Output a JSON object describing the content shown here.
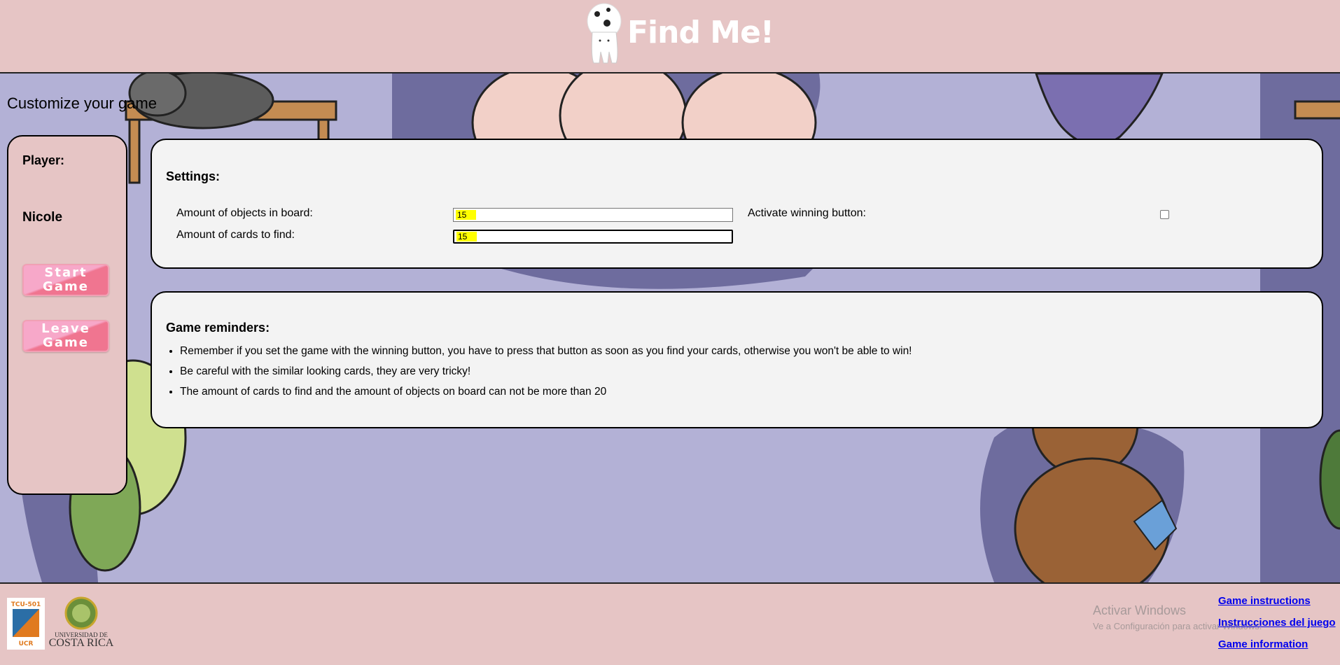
{
  "header": {
    "title": "Find Me!"
  },
  "main": {
    "heading": "Customize your game",
    "sidebar": {
      "player_label": "Player:",
      "player_name": "Nicole",
      "start_button": "Start Game",
      "leave_button": "Leave Game"
    },
    "settings": {
      "title": "Settings:",
      "objects_label": "Amount of objects in board:",
      "objects_value": "15",
      "cards_label": "Amount of cards to find:",
      "cards_value": "15",
      "winning_label": "Activate winning button:",
      "winning_checked": false
    },
    "reminders": {
      "title": "Game reminders:",
      "items": [
        "Remember if you set the game with the winning button, you have to press that button as soon as you find your cards, otherwise you won't be able to win!",
        "Be careful with the similar looking cards, they are very tricky!",
        "The amount of cards to find and the amount of objects on board can not be more than 20"
      ]
    }
  },
  "footer": {
    "tcu_logo_text": "TCU-501",
    "tcu_logo_sub": "UCR",
    "ucr_line1": "UNIVERSIDAD DE",
    "ucr_line2": "COSTA RICA",
    "watermark_title": "Activar Windows",
    "watermark_sub": "Ve a Configuración para activar Windows.",
    "links": [
      "Game instructions",
      "Instrucciones del juego",
      "Game information"
    ]
  },
  "colors": {
    "page_bg": "#e6c5c5",
    "scene_bg": "#b3b1d6",
    "panel_bg": "#f3f3f3",
    "button_pink": "#f07590",
    "link_blue": "#0000ee",
    "highlight": "#ffff00"
  },
  "icons": [
    "ghost-mascot-icon",
    "checkbox-icon"
  ]
}
